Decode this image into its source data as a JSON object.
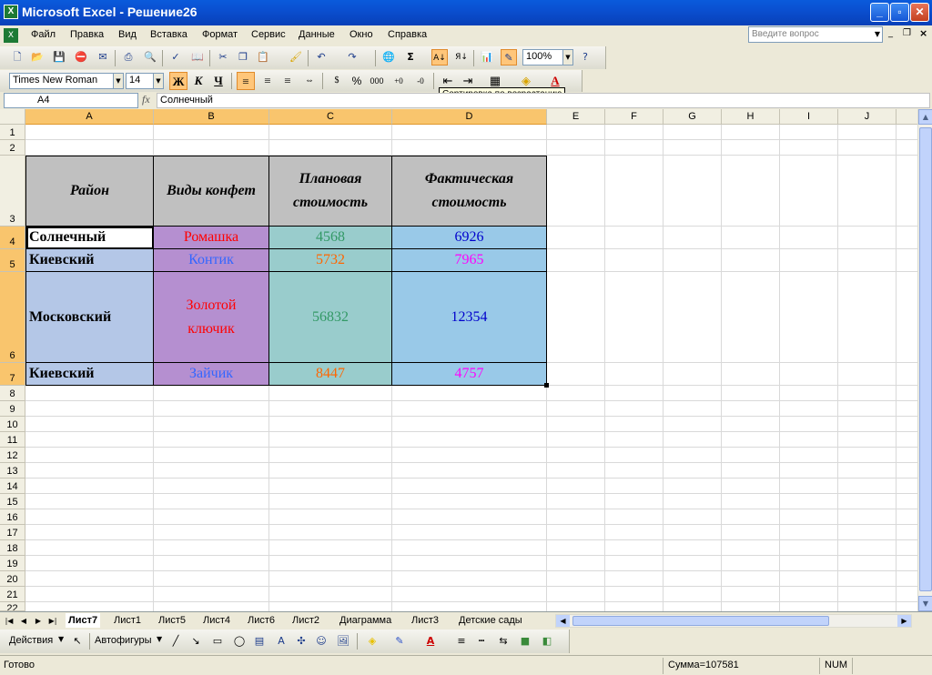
{
  "window": {
    "title": "Microsoft Excel - Решение26",
    "app_icon": "excel-icon",
    "minimize": "_",
    "maximize": "▫",
    "close": "✕"
  },
  "menu": {
    "items": [
      "Файл",
      "Правка",
      "Вид",
      "Вставка",
      "Формат",
      "Сервис",
      "Данные",
      "Окно",
      "Справка"
    ],
    "ask_placeholder": "Введите вопрос"
  },
  "standard_toolbar": {
    "zoom": "100%",
    "icons": [
      "new-icon",
      "open-icon",
      "save-icon",
      "permission-icon",
      "email-icon",
      "print-icon",
      "print-preview-icon",
      "spelling-icon",
      "research-icon",
      "cut-icon",
      "copy-icon",
      "paste-icon",
      "format-painter-icon",
      "undo-icon",
      "redo-icon",
      "hyperlink-icon",
      "autosum-icon",
      "sort-ascending-icon",
      "sort-descending-icon",
      "chart-wizard-icon",
      "drawing-icon",
      "help-icon"
    ]
  },
  "format_toolbar": {
    "font": "Times New Roman",
    "size": "14",
    "bold": "Ж",
    "italic": "К",
    "underline": "Ч",
    "percent": "%",
    "thousands": "000",
    "tooltip": "Сортировка по возрастанию"
  },
  "formula_bar": {
    "name_box": "A4",
    "fx": "fx",
    "content": "Солнечный"
  },
  "columns": [
    "A",
    "B",
    "C",
    "D",
    "E",
    "F",
    "G",
    "H",
    "I",
    "J"
  ],
  "rows": [
    "1",
    "2",
    "3",
    "4",
    "5",
    "6",
    "7",
    "8",
    "9",
    "10",
    "11",
    "12",
    "13",
    "14",
    "15",
    "16",
    "17",
    "18",
    "19",
    "20",
    "21",
    "22"
  ],
  "table": {
    "headers": {
      "a": "Район",
      "b": "Виды конфет",
      "c": "Плановая стоимость",
      "d": "Фактическая стоимость"
    },
    "rows": [
      {
        "a": "Солнечный",
        "b": "Ромашка",
        "c": "4568",
        "d": "6926"
      },
      {
        "a": "Киевский",
        "b": "Контик",
        "c": "5732",
        "d": "7965"
      },
      {
        "a": "Московский",
        "b": "Золотой ключик",
        "c": "56832",
        "d": "12354"
      },
      {
        "a": "Киевский",
        "b": "Зайчик",
        "c": "8447",
        "d": "4757"
      }
    ],
    "colors": {
      "header_bg": "#c0c0c0",
      "col_a_bg": "#b4c7e7",
      "col_b_bg": "#b58fd0",
      "col_c_bg": "#99cccc",
      "col_d_bg": "#99c9e8",
      "text_red": "#ff0000",
      "text_blue": "#3366ff",
      "text_green": "#339966",
      "text_orange": "#ff6600",
      "text_navy": "#0000cc",
      "text_magenta": "#ff00ff"
    }
  },
  "sheets": {
    "tabs": [
      "Лист7",
      "Лист1",
      "Лист5",
      "Лист4",
      "Лист6",
      "Лист2",
      "Диаграмма",
      "Лист3",
      "Детские сады"
    ],
    "active": "Лист7"
  },
  "drawing_toolbar": {
    "actions": "Действия",
    "autoshapes": "Автофигуры"
  },
  "status": {
    "ready": "Готово",
    "sum": "Сумма=107581",
    "num": "NUM"
  }
}
